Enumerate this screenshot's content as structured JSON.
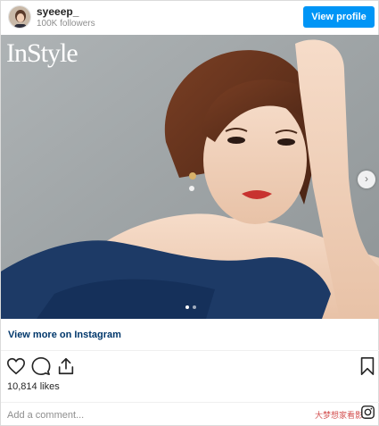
{
  "header": {
    "username": "syeeep_",
    "followers": "100K followers",
    "view_profile_label": "View profile"
  },
  "photo": {
    "magazine_logo": "InStyle",
    "next_icon": "chevron-right-icon",
    "carousel_dots": 2
  },
  "links": {
    "view_more": "View more on Instagram"
  },
  "actions": {
    "icons": [
      "heart-icon",
      "comment-icon",
      "share-icon",
      "bookmark-icon"
    ],
    "likes": "10,814 likes"
  },
  "comment": {
    "placeholder": "Add a comment..."
  },
  "watermark": "大梦想家看影",
  "colors": {
    "accent": "#0095f6",
    "link": "#00376b",
    "muted": "#8e8e8e"
  }
}
